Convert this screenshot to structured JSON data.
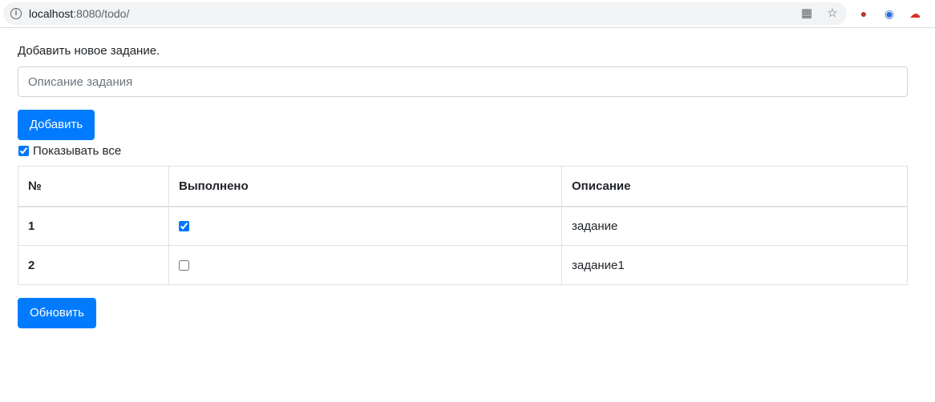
{
  "browser": {
    "url_host": "localhost",
    "url_rest": ":8080/todo/"
  },
  "page": {
    "title": "Добавить новое задание.",
    "input_placeholder": "Описание задания",
    "add_button": "Добавить",
    "show_all_label": "Показывать все",
    "show_all_checked": true,
    "refresh_button": "Обновить"
  },
  "table": {
    "headers": [
      "№",
      "Выполнено",
      "Описание"
    ],
    "rows": [
      {
        "num": "1",
        "done": true,
        "description": "задание"
      },
      {
        "num": "2",
        "done": false,
        "description": "задание1"
      }
    ]
  },
  "colors": {
    "primary": "#007bff",
    "border": "#dee2e6"
  }
}
